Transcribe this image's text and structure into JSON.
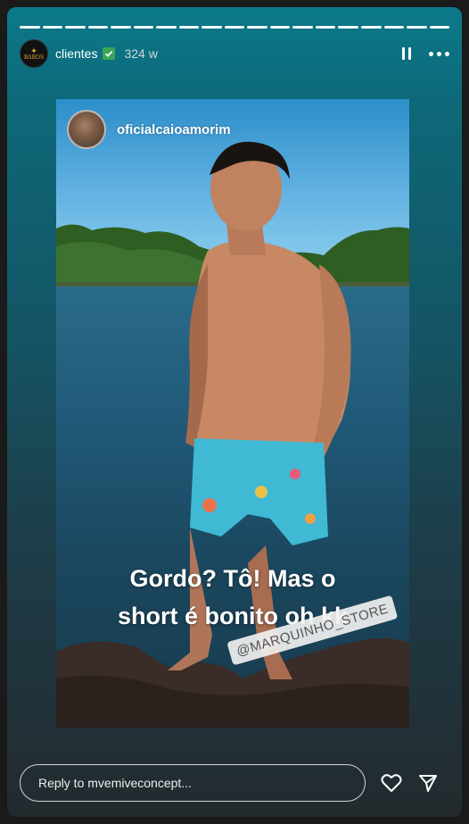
{
  "progress": {
    "segments": 19,
    "filled": 19
  },
  "header": {
    "account_name": "clientes",
    "verified": true,
    "time_ago": "324 w",
    "avatar_logo_text": "BAROS"
  },
  "media": {
    "author": "oficialcaioamorim",
    "caption_line1": "Gordo? Tô! Mas o",
    "caption_line2": "short é bonito oh kk",
    "mention_tag": "@MARQUINHO_STORE"
  },
  "footer": {
    "reply_placeholder": "Reply to mvemiveconcept..."
  },
  "colors": {
    "story_top": "#0b7a8a",
    "story_bottom": "#232a2e",
    "verified_badge": "#3aa657"
  },
  "icons": [
    "pause-icon",
    "more-icon",
    "heart-icon",
    "send-icon",
    "verified-icon"
  ]
}
